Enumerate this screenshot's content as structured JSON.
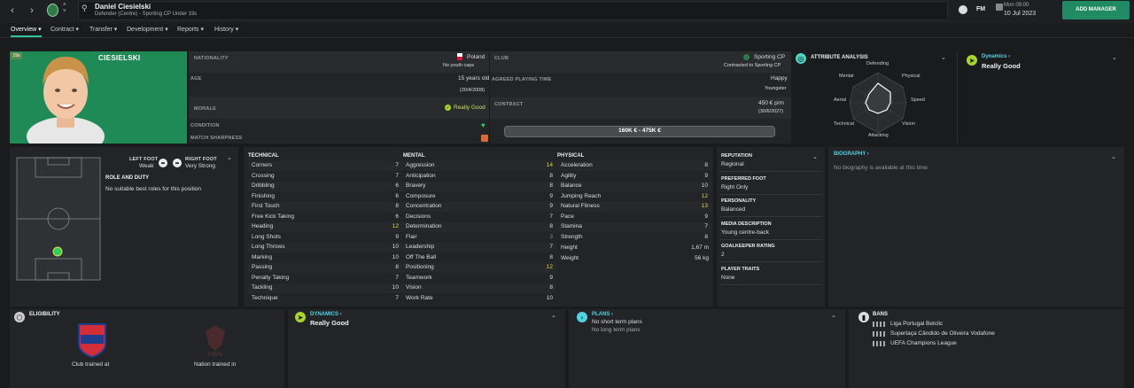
{
  "player": {
    "name": "Daniel Ciesielski",
    "subtitle": "Defender (Centre) - Sporting CP Under 19s",
    "surname": "CIESIELSKI",
    "age_badge": "19s"
  },
  "topbar": {
    "fm": "FM",
    "date_day": "Mon 09:00",
    "date": "10 Jul 2023",
    "add_manager": "ADD MANAGER"
  },
  "menu": [
    "Overview",
    "Contract",
    "Transfer",
    "Development",
    "Reports",
    "History"
  ],
  "info": {
    "nationality_label": "NATIONALITY",
    "nationality": "Poland",
    "youth_caps": "No youth caps",
    "club_label": "CLUB",
    "club": "Sporting CP",
    "contract_status": "Contracted to Sporting CP",
    "age_label": "AGE",
    "age": "15 years old",
    "dob": "(20/4/2008)",
    "playing_time_label": "AGREED PLAYING TIME",
    "playing_time_mood": "Happy",
    "playing_time": "Youngster",
    "morale_label": "MORALE",
    "morale": "Really Good",
    "contract_label": "CONTRACT",
    "wage": "450 € p/m",
    "contract_end": "(30/6/2027)",
    "condition_label": "CONDITION",
    "sharpness_label": "MATCH SHARPNESS",
    "value_range": "160K € - 475K €"
  },
  "attribute_analysis": {
    "title": "ATTRIBUTE ANALYSIS",
    "axes": [
      "Defending",
      "Physical",
      "Speed",
      "Vision",
      "Attacking",
      "Technical",
      "Aerial",
      "Mental"
    ]
  },
  "dynamics_top": {
    "title": "Dynamics",
    "value": "Really Good"
  },
  "feet": {
    "left_label": "LEFT FOOT",
    "left": "Weak",
    "right_label": "RIGHT FOOT",
    "right": "Very Strong"
  },
  "roles": {
    "title": "ROLE AND DUTY",
    "text": "No suitable best roles for this position"
  },
  "technical": {
    "title": "TECHNICAL",
    "rows": [
      {
        "name": "Corners",
        "value": "7"
      },
      {
        "name": "Crossing",
        "value": "7"
      },
      {
        "name": "Dribbling",
        "value": "6"
      },
      {
        "name": "Finishing",
        "value": "6"
      },
      {
        "name": "First Touch",
        "value": "8"
      },
      {
        "name": "Free Kick Taking",
        "value": "6"
      },
      {
        "name": "Heading",
        "value": "12"
      },
      {
        "name": "Long Shots",
        "value": "9"
      },
      {
        "name": "Long Throws",
        "value": "10"
      },
      {
        "name": "Marking",
        "value": "10"
      },
      {
        "name": "Passing",
        "value": "8"
      },
      {
        "name": "Penalty Taking",
        "value": "7"
      },
      {
        "name": "Tackling",
        "value": "10"
      },
      {
        "name": "Technique",
        "value": "7"
      }
    ]
  },
  "mental": {
    "title": "MENTAL",
    "rows": [
      {
        "name": "Aggression",
        "value": "14"
      },
      {
        "name": "Anticipation",
        "value": "8"
      },
      {
        "name": "Bravery",
        "value": "8"
      },
      {
        "name": "Composure",
        "value": "9"
      },
      {
        "name": "Concentration",
        "value": "9"
      },
      {
        "name": "Decisions",
        "value": "7"
      },
      {
        "name": "Determination",
        "value": "8"
      },
      {
        "name": "Flair",
        "value": "3"
      },
      {
        "name": "Leadership",
        "value": "7"
      },
      {
        "name": "Off The Ball",
        "value": "8"
      },
      {
        "name": "Positioning",
        "value": "12"
      },
      {
        "name": "Teamwork",
        "value": "9"
      },
      {
        "name": "Vision",
        "value": "8"
      },
      {
        "name": "Work Rate",
        "value": "10"
      }
    ]
  },
  "physical": {
    "title": "PHYSICAL",
    "rows": [
      {
        "name": "Acceleration",
        "value": "8"
      },
      {
        "name": "Agility",
        "value": "9"
      },
      {
        "name": "Balance",
        "value": "10"
      },
      {
        "name": "Jumping Reach",
        "value": "12"
      },
      {
        "name": "Natural Fitness",
        "value": "13"
      },
      {
        "name": "Pace",
        "value": "9"
      },
      {
        "name": "Stamina",
        "value": "7"
      },
      {
        "name": "Strength",
        "value": "8"
      }
    ],
    "height_label": "Height",
    "height": "1,67 m",
    "weight_label": "Weight",
    "weight": "56 kg"
  },
  "side": [
    {
      "label": "REPUTATION",
      "value": "Regional"
    },
    {
      "label": "PREFERRED FOOT",
      "value": "Right Only"
    },
    {
      "label": "PERSONALITY",
      "value": "Balanced"
    },
    {
      "label": "MEDIA DESCRIPTION",
      "value": "Young centre-back"
    },
    {
      "label": "GOALKEEPER RATING",
      "value": "2"
    },
    {
      "label": "PLAYER TRAITS",
      "value": "None"
    }
  ],
  "biography": {
    "title": "BIOGRAPHY",
    "text": "No biography is available at this time."
  },
  "eligibility": {
    "title": "ELIGIBILITY",
    "club_trained": "Club trained at",
    "nation_trained": "Nation trained in"
  },
  "dynamics_bottom": {
    "title": "DYNAMICS",
    "value": "Really Good"
  },
  "plans": {
    "title": "PLANS",
    "short": "No short term plans",
    "long": "No long term plans"
  },
  "bans": {
    "title": "BANS",
    "items": [
      "Liga Portugal Betclic",
      "Supertaça Cândido de Oliveira Vodafone",
      "UEFA Champions League"
    ]
  },
  "colors": {
    "accent": "#2ec4a0",
    "highlight": "#e7d94a",
    "portrait_bg": "#1f8a55",
    "good": "#a8d42e"
  }
}
